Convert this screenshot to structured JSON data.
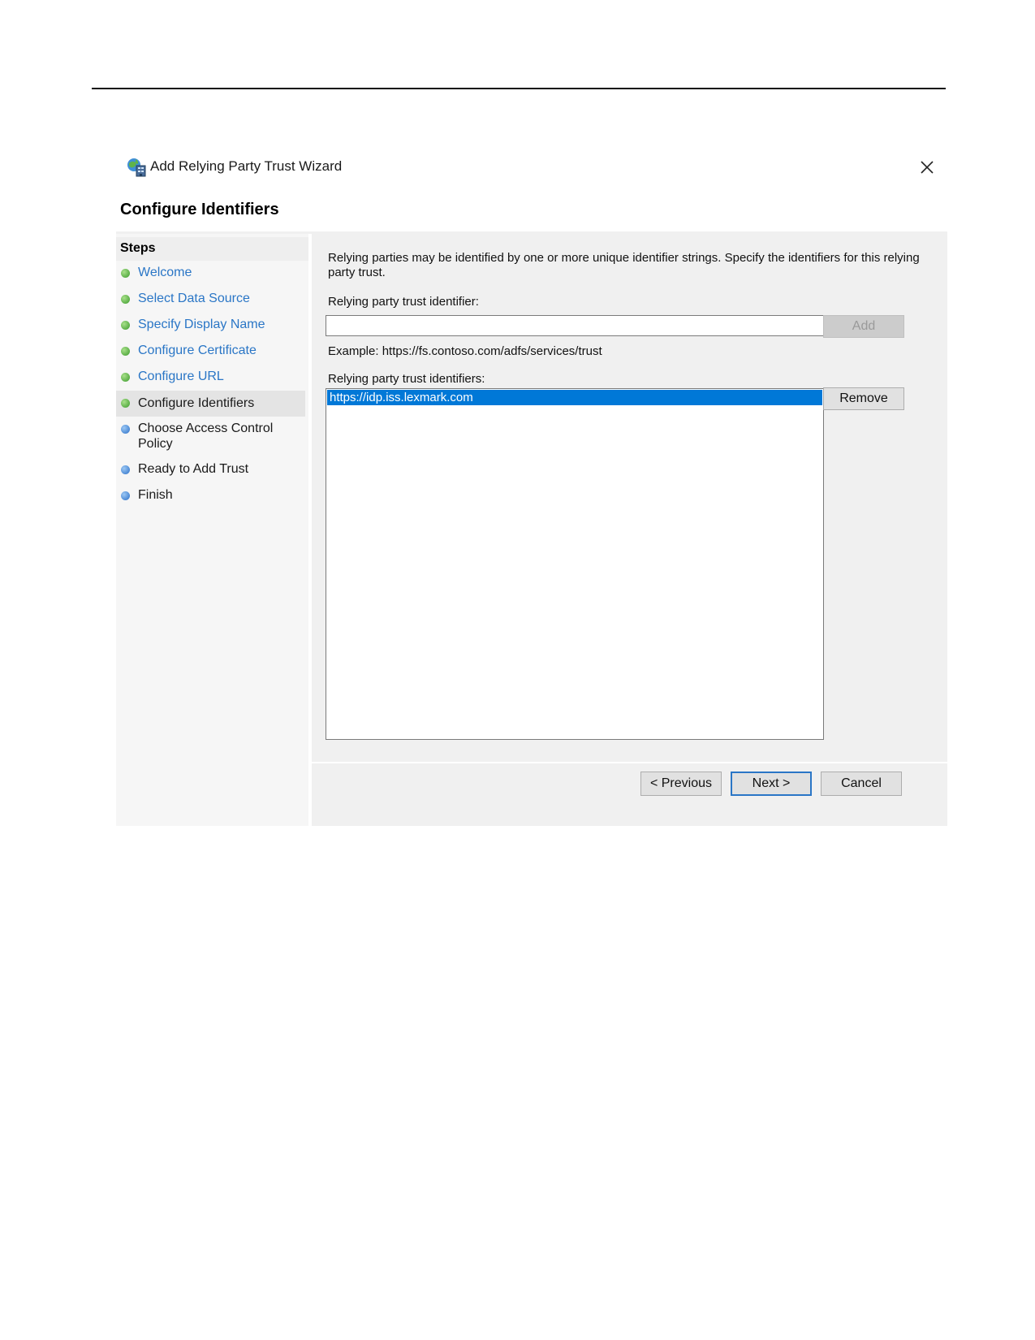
{
  "window": {
    "title": "Add Relying Party Trust Wizard",
    "icon": "relying-party-trust-icon",
    "close_glyph": "✕"
  },
  "page": {
    "heading": "Configure Identifiers"
  },
  "steps": {
    "header": "Steps",
    "items": [
      {
        "label": "Welcome",
        "state": "completed"
      },
      {
        "label": "Select Data Source",
        "state": "completed"
      },
      {
        "label": "Specify Display Name",
        "state": "completed"
      },
      {
        "label": "Configure Certificate",
        "state": "completed"
      },
      {
        "label": "Configure URL",
        "state": "completed"
      },
      {
        "label": "Configure Identifiers",
        "state": "current"
      },
      {
        "label": "Choose Access Control Policy",
        "state": "pending"
      },
      {
        "label": "Ready to Add Trust",
        "state": "pending"
      },
      {
        "label": "Finish",
        "state": "pending"
      }
    ]
  },
  "content": {
    "description": "Relying parties may be identified by one or more unique identifier strings. Specify the identifiers for this relying party trust.",
    "identifier_label": "Relying party trust identifier:",
    "identifier_value": "",
    "add_label": "Add",
    "example": "Example: https://fs.contoso.com/adfs/services/trust",
    "identifiers_label": "Relying party trust identifiers:",
    "identifiers": [
      "https://idp.iss.lexmark.com"
    ],
    "remove_label": "Remove"
  },
  "footer": {
    "previous_label": "< Previous",
    "next_label": "Next >",
    "cancel_label": "Cancel"
  },
  "colors": {
    "link": "#2a76c6",
    "selection": "#0078d7",
    "completed_dot": "#3a9a2a",
    "pending_dot": "#2a6fc8"
  }
}
